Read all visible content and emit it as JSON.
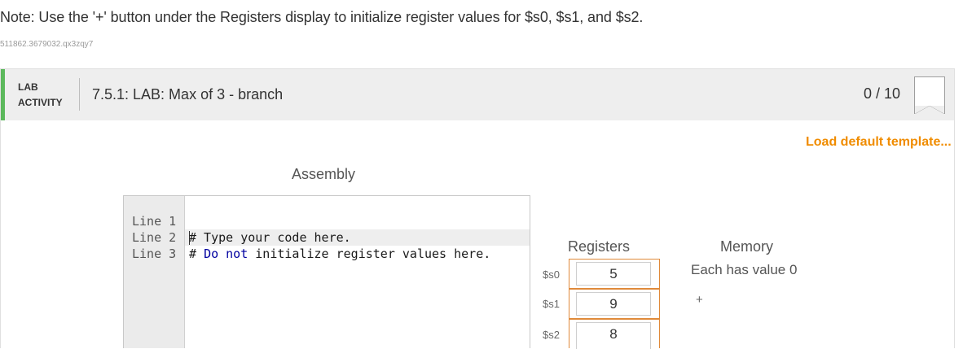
{
  "note": "Note: Use the '+' button under the Registers display to initialize register values for $s0, $s1, and $s2.",
  "activity_id": "511862.3679032.qx3zqy7",
  "lab": {
    "type_line1": "LAB",
    "type_line2": "ACTIVITY",
    "title": "7.5.1: LAB: Max of 3 - branch",
    "score": "0 / 10",
    "accent_color": "#5cb85c"
  },
  "load_template": "Load default template...",
  "assembly": {
    "label": "Assembly",
    "lines": [
      {
        "number": "Line 1",
        "code": "# Type your code here."
      },
      {
        "number": "Line 2",
        "code_prefix": "# ",
        "kw1": "Do",
        "mid1": " ",
        "kw2": "not",
        "rest": " initialize register values here."
      },
      {
        "number": "Line 3",
        "code": ""
      }
    ]
  },
  "registers": {
    "label": "Registers",
    "items": [
      {
        "name": "$s0",
        "value": "5"
      },
      {
        "name": "$s1",
        "value": "9"
      },
      {
        "name": "$s2",
        "value": "8"
      }
    ]
  },
  "memory": {
    "label": "Memory",
    "text": "Each has value 0",
    "add_button": "+"
  }
}
